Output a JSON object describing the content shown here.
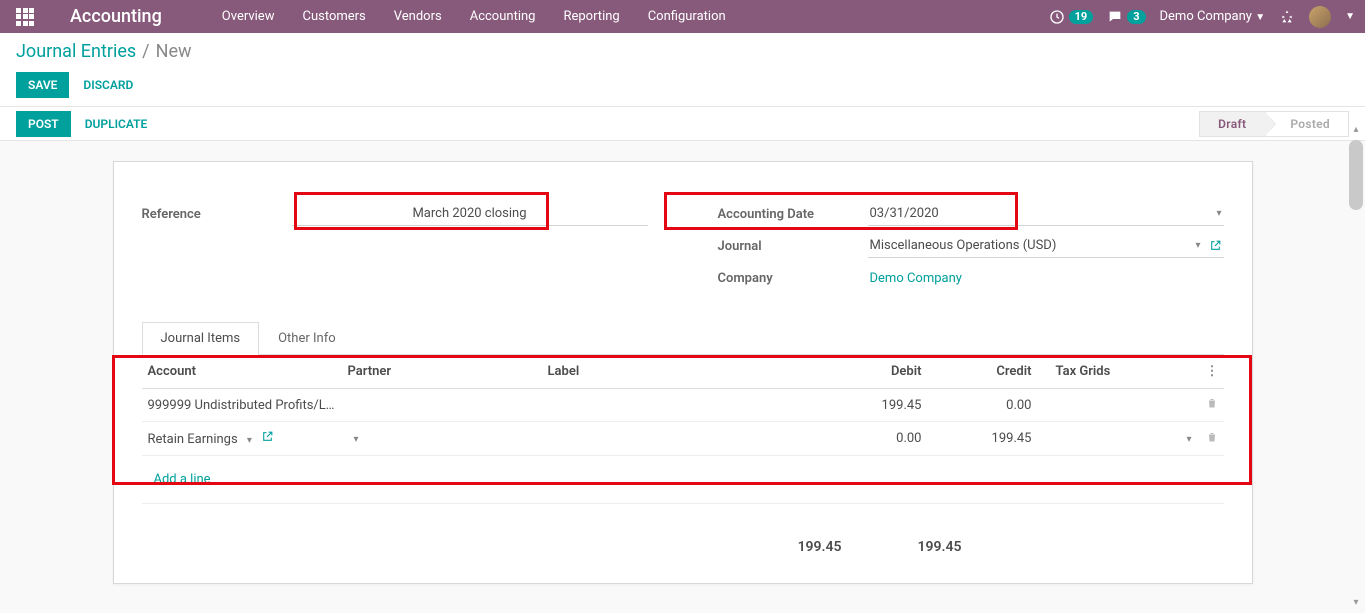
{
  "navbar": {
    "brand": "Accounting",
    "menu": [
      "Overview",
      "Customers",
      "Vendors",
      "Accounting",
      "Reporting",
      "Configuration"
    ],
    "activity_count": "19",
    "discuss_count": "3",
    "company": "Demo Company"
  },
  "breadcrumb": {
    "parent": "Journal Entries",
    "current": "New"
  },
  "buttons": {
    "save": "Save",
    "discard": "Discard",
    "post": "Post",
    "duplicate": "Duplicate"
  },
  "status": {
    "draft": "Draft",
    "posted": "Posted"
  },
  "form": {
    "reference_label": "Reference",
    "reference_value": "March 2020 closing",
    "date_label": "Accounting Date",
    "date_value": "03/31/2020",
    "journal_label": "Journal",
    "journal_value": "Miscellaneous Operations (USD)",
    "company_label": "Company",
    "company_value": "Demo Company"
  },
  "tabs": {
    "items": "Journal Items",
    "other": "Other Info"
  },
  "table": {
    "headers": {
      "account": "Account",
      "partner": "Partner",
      "label": "Label",
      "debit": "Debit",
      "credit": "Credit",
      "tax": "Tax Grids"
    },
    "rows": [
      {
        "account": "999999 Undistributed Profits/L…",
        "partner": "",
        "label": "",
        "debit": "199.45",
        "credit": "0.00",
        "editing": false
      },
      {
        "account": "Retain Earnings",
        "partner": "",
        "label": "",
        "debit": "0.00",
        "credit": "199.45",
        "editing": true
      }
    ],
    "add_line": "Add a line",
    "totals": {
      "debit": "199.45",
      "credit": "199.45"
    }
  }
}
